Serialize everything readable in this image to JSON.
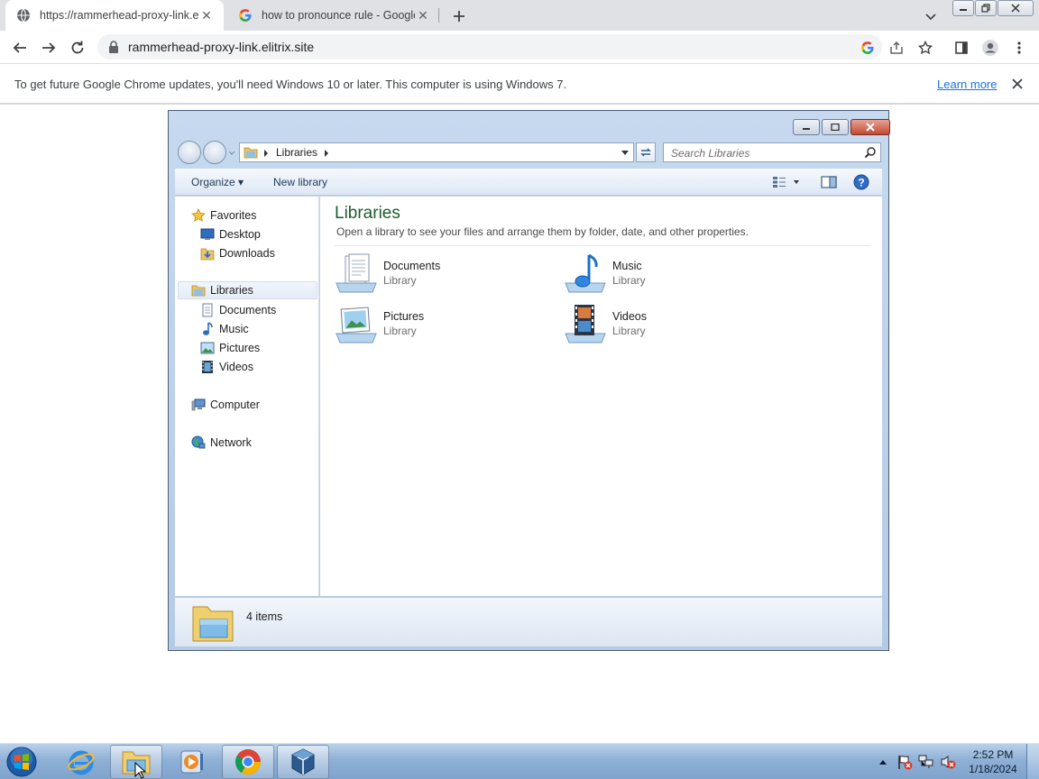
{
  "browser": {
    "tabs": [
      {
        "title": "https://rammerhead-proxy-link.e",
        "icon": "globe-icon",
        "active": true
      },
      {
        "title": "how to pronounce rule - Google",
        "icon": "google-icon",
        "active": false
      }
    ],
    "url": "rammerhead-proxy-link.elitrix.site",
    "infobar": {
      "message": "To get future Google Chrome updates, you'll need Windows 10 or later. This computer is using Windows 7.",
      "link": "Learn more"
    },
    "accent": "#1a73e8"
  },
  "explorer": {
    "breadcrumb": "Libraries",
    "search_placeholder": "Search Libraries",
    "commands": {
      "organize": "Organize",
      "new_library": "New library"
    },
    "nav": {
      "favorites": "Favorites",
      "desktop": "Desktop",
      "downloads": "Downloads",
      "libraries": "Libraries",
      "documents": "Documents",
      "music": "Music",
      "pictures": "Pictures",
      "videos": "Videos",
      "computer": "Computer",
      "network": "Network"
    },
    "content": {
      "title": "Libraries",
      "subtitle": "Open a library to see your files and arrange them by folder, date, and other properties.",
      "items": [
        {
          "name": "Documents",
          "type": "Library"
        },
        {
          "name": "Music",
          "type": "Library"
        },
        {
          "name": "Pictures",
          "type": "Library"
        },
        {
          "name": "Videos",
          "type": "Library"
        }
      ]
    },
    "status": "4 items"
  },
  "taskbar": {
    "time": "2:52 PM",
    "date": "1/18/2024"
  }
}
